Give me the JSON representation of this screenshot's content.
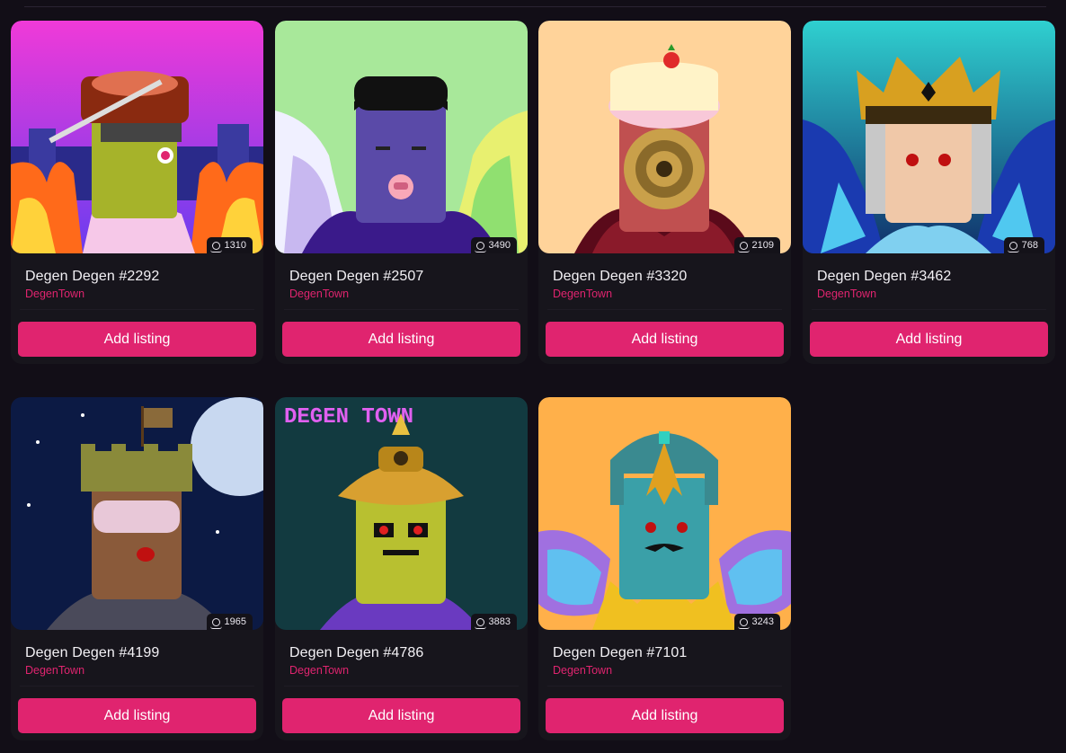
{
  "cards": [
    {
      "name": "Degen Degen #2292",
      "collection": "DegenTown",
      "rank": "1310",
      "button": "Add listing",
      "colors": {
        "bg_top": "#f03ad8",
        "bg_bottom": "#7a3cf0",
        "skin": "#a6b32a",
        "accent": "#ff6a1a"
      }
    },
    {
      "name": "Degen Degen #2507",
      "collection": "DegenTown",
      "rank": "3490",
      "button": "Add listing",
      "colors": {
        "bg_top": "#a8e89a",
        "bg_bottom": "#a8e89a",
        "skin": "#5a4aa8",
        "accent": "#3a1a8a"
      }
    },
    {
      "name": "Degen Degen #3320",
      "collection": "DegenTown",
      "rank": "2109",
      "button": "Add listing",
      "colors": {
        "bg_top": "#ffd39a",
        "bg_bottom": "#ffd39a",
        "skin": "#c9a04a",
        "accent": "#8a1a2a"
      }
    },
    {
      "name": "Degen Degen #3462",
      "collection": "DegenTown",
      "rank": "768",
      "button": "Add listing",
      "colors": {
        "bg_top": "#2fd0d0",
        "bg_bottom": "#10306a",
        "skin": "#f0c8a8",
        "accent": "#2040c0"
      }
    },
    {
      "name": "Degen Degen #4199",
      "collection": "DegenTown",
      "rank": "1965",
      "button": "Add listing",
      "colors": {
        "bg_top": "#0a1a40",
        "bg_bottom": "#1a2a60",
        "skin": "#8a5a3a",
        "accent": "#8a8a3a"
      }
    },
    {
      "name": "Degen Degen #4786",
      "collection": "DegenTown",
      "rank": "3883",
      "button": "Add listing",
      "colors": {
        "bg_top": "#10303a",
        "bg_bottom": "#16454a",
        "skin": "#b8c030",
        "accent": "#d8a030"
      }
    },
    {
      "name": "Degen Degen #7101",
      "collection": "DegenTown",
      "rank": "3243",
      "button": "Add listing",
      "colors": {
        "bg_top": "#ffb04a",
        "bg_bottom": "#ffb04a",
        "skin": "#3aa0a8",
        "accent": "#e0a020"
      }
    }
  ],
  "art_signs": {
    "card6_neon": "DEGEN TOWN"
  },
  "theme": {
    "page_bg": "#120e17",
    "card_bg": "#17151c",
    "accent": "#e0246f"
  }
}
